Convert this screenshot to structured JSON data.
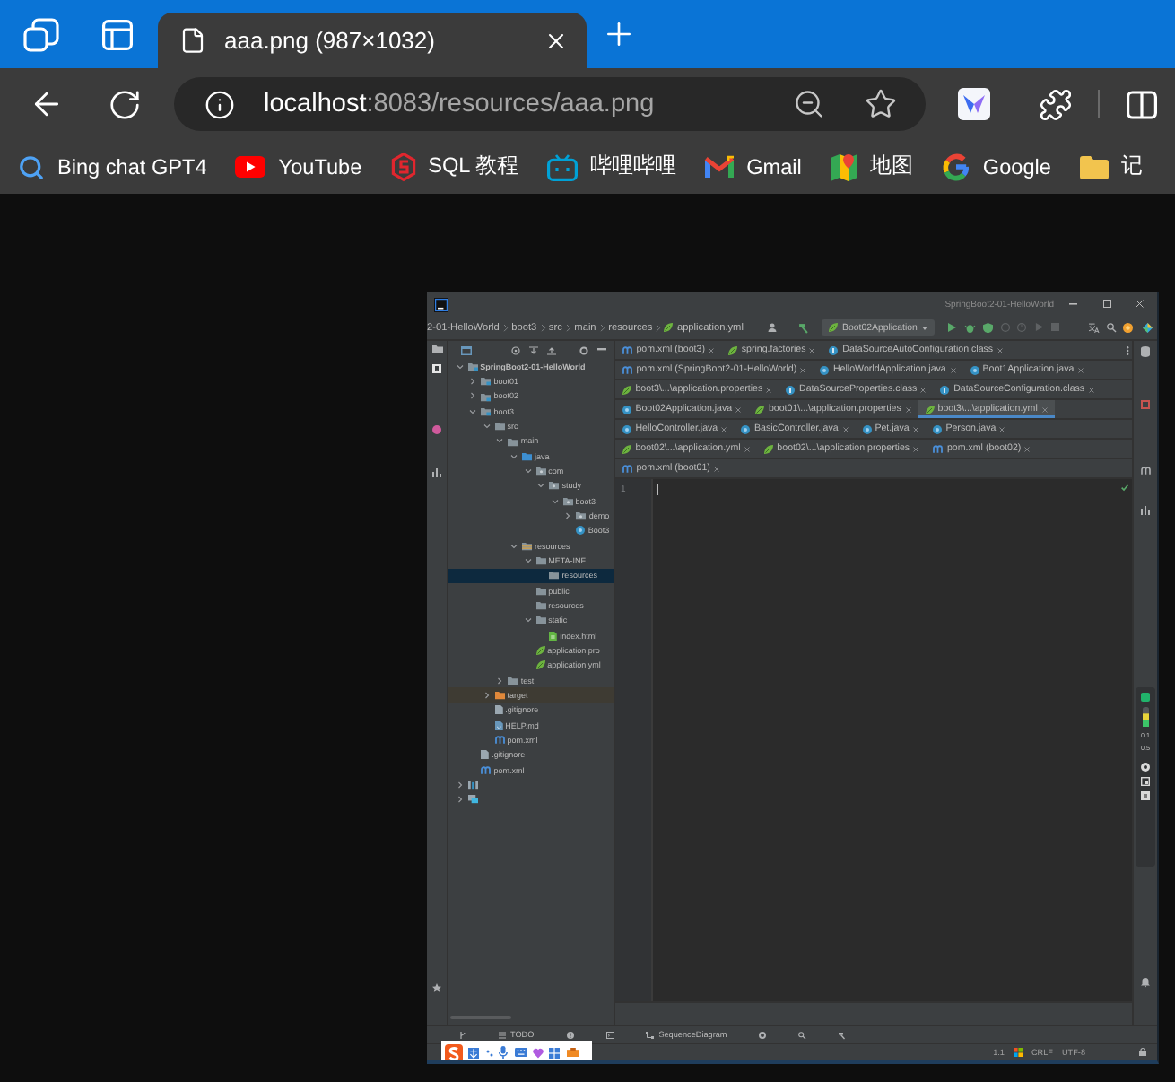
{
  "browser": {
    "tab": {
      "title": "aaa.png (987×1032)",
      "selected": true
    },
    "address": {
      "host": "localhost",
      "path": ":8083/resources/aaa.png"
    },
    "bookmarks": [
      {
        "kind": "search",
        "label": "Bing chat GPT4"
      },
      {
        "kind": "video",
        "label": "YouTube"
      },
      {
        "kind": "sql",
        "label": "SQL 教程"
      },
      {
        "kind": "tv",
        "label": "哔哩哔哩"
      },
      {
        "kind": "mail",
        "label": "Gmail"
      },
      {
        "kind": "map",
        "label": "地图"
      },
      {
        "kind": "google",
        "label": "Google"
      },
      {
        "kind": "folder",
        "label": "记"
      }
    ]
  },
  "ide": {
    "window_title": "SpringBoot2-01-HelloWorld",
    "breadcrumbs": [
      {
        "kind": "folder",
        "label": "2-01-HelloWorld"
      },
      {
        "kind": "folder",
        "label": "boot3"
      },
      {
        "kind": "folder",
        "label": "src"
      },
      {
        "kind": "folder",
        "label": "main"
      },
      {
        "kind": "folder",
        "label": "resources"
      },
      {
        "kind": "spring-config",
        "label": "application.yml"
      }
    ],
    "run_configuration": "Boot02Application",
    "project_tree": [
      {
        "kind": "module",
        "label": "SpringBoot2-01-HelloWorld",
        "expanded": true,
        "selected": false,
        "children": [
          {
            "kind": "module",
            "label": "boot01",
            "expanded": false,
            "selected": false
          },
          {
            "kind": "module",
            "label": "boot02",
            "expanded": false,
            "selected": false
          },
          {
            "kind": "module",
            "label": "boot3",
            "expanded": true,
            "selected": false,
            "children": [
              {
                "kind": "folder",
                "label": "src",
                "expanded": true,
                "selected": false,
                "children": [
                  {
                    "kind": "folder",
                    "label": "main",
                    "expanded": true,
                    "selected": false,
                    "children": [
                      {
                        "kind": "source-folder",
                        "label": "java",
                        "expanded": true,
                        "selected": false,
                        "children": [
                          {
                            "kind": "package",
                            "label": "com",
                            "expanded": true,
                            "selected": false,
                            "children": [
                              {
                                "kind": "package",
                                "label": "study",
                                "expanded": true,
                                "selected": false,
                                "children": [
                                  {
                                    "kind": "package",
                                    "label": "boot3",
                                    "expanded": true,
                                    "selected": false,
                                    "children": [
                                      {
                                        "kind": "package",
                                        "label": "demo",
                                        "expanded": false,
                                        "selected": false
                                      },
                                      {
                                        "kind": "java",
                                        "label": "Boot3",
                                        "selected": false
                                      }
                                    ]
                                  }
                                ]
                              }
                            ]
                          }
                        ]
                      },
                      {
                        "kind": "resources-folder",
                        "label": "resources",
                        "expanded": true,
                        "selected": false,
                        "children": [
                          {
                            "kind": "folder",
                            "label": "META-INF",
                            "expanded": true,
                            "selected": false,
                            "children": [
                              {
                                "kind": "folder",
                                "label": "resources",
                                "selected": true
                              }
                            ]
                          },
                          {
                            "kind": "folder",
                            "label": "public",
                            "selected": false
                          },
                          {
                            "kind": "folder",
                            "label": "resources",
                            "selected": false
                          },
                          {
                            "kind": "folder",
                            "label": "static",
                            "expanded": true,
                            "selected": false,
                            "children": [
                              {
                                "kind": "html",
                                "label": "index.html",
                                "selected": false
                              }
                            ]
                          },
                          {
                            "kind": "spring-config",
                            "label": "application.pro",
                            "selected": false
                          },
                          {
                            "kind": "spring-config",
                            "label": "application.yml",
                            "selected": false
                          }
                        ]
                      }
                    ]
                  },
                  {
                    "kind": "folder",
                    "label": "test",
                    "expanded": false,
                    "selected": false
                  }
                ]
              },
              {
                "kind": "excluded-folder",
                "label": "target",
                "expanded": false,
                "selected": false
              },
              {
                "kind": "gitignore",
                "label": ".gitignore",
                "selected": false
              },
              {
                "kind": "markdown",
                "label": "HELP.md",
                "selected": false
              },
              {
                "kind": "maven",
                "label": "pom.xml",
                "selected": false
              }
            ]
          },
          {
            "kind": "gitignore",
            "label": ".gitignore",
            "selected": false
          },
          {
            "kind": "maven",
            "label": "pom.xml",
            "selected": false
          }
        ]
      },
      {
        "kind": "library",
        "expanded": false,
        "selected": false
      },
      {
        "kind": "scratches",
        "expanded": false,
        "selected": false
      }
    ],
    "editor_tab_rows": [
      {
        "tabs": [
          {
            "kind": "maven",
            "label": "pom.xml (boot3)",
            "selected": false
          },
          {
            "kind": "spring-config",
            "label": "spring.factories",
            "selected": false
          },
          {
            "kind": "class",
            "label": "DataSourceAutoConfiguration.class",
            "selected": false
          }
        ]
      },
      {
        "tabs": [
          {
            "kind": "maven",
            "label": "pom.xml (SpringBoot2-01-HelloWorld)",
            "selected": false
          },
          {
            "kind": "java",
            "label": "HelloWorldApplication.java",
            "selected": false
          },
          {
            "kind": "java",
            "label": "Boot1Application.java",
            "selected": false
          }
        ]
      },
      {
        "tabs": [
          {
            "kind": "spring-config",
            "label": "boot3\\...\\application.properties",
            "selected": false
          },
          {
            "kind": "class",
            "label": "DataSourceProperties.class",
            "selected": false
          },
          {
            "kind": "class",
            "label": "DataSourceConfiguration.class",
            "selected": false
          }
        ]
      },
      {
        "tabs": [
          {
            "kind": "java",
            "label": "Boot02Application.java",
            "selected": false
          },
          {
            "kind": "spring-config",
            "label": "boot01\\...\\application.properties",
            "selected": false
          },
          {
            "kind": "spring-config",
            "label": "boot3\\...\\application.yml",
            "selected": true
          }
        ]
      },
      {
        "tabs": [
          {
            "kind": "java",
            "label": "HelloController.java",
            "selected": false
          },
          {
            "kind": "java",
            "label": "BasicController.java",
            "selected": false
          },
          {
            "kind": "java",
            "label": "Pet.java",
            "selected": false
          },
          {
            "kind": "java",
            "label": "Person.java",
            "selected": false
          }
        ]
      },
      {
        "tabs": [
          {
            "kind": "spring-config",
            "label": "boot02\\...\\application.yml",
            "selected": false
          },
          {
            "kind": "spring-config",
            "label": "boot02\\...\\application.properties",
            "selected": false
          },
          {
            "kind": "maven",
            "label": "pom.xml (boot02)",
            "selected": false
          }
        ]
      },
      {
        "tabs": [
          {
            "kind": "maven",
            "label": "pom.xml (boot01)",
            "selected": false
          }
        ]
      }
    ],
    "line_numbers": [
      "1"
    ],
    "network_readings": [
      "0.1",
      "0.5"
    ],
    "tool_windows": [
      {
        "kind": "vcs"
      },
      {
        "kind": "todo",
        "label": "TODO"
      },
      {
        "kind": "problems"
      },
      {
        "kind": "terminal"
      },
      {
        "kind": "diagram",
        "label": "SequenceDiagram"
      },
      {
        "kind": "services"
      },
      {
        "kind": "profiler"
      },
      {
        "kind": "build"
      }
    ],
    "status_bar": {
      "caret_position": "1:1",
      "line_separator": "CRLF",
      "encoding": "UTF-8"
    }
  }
}
